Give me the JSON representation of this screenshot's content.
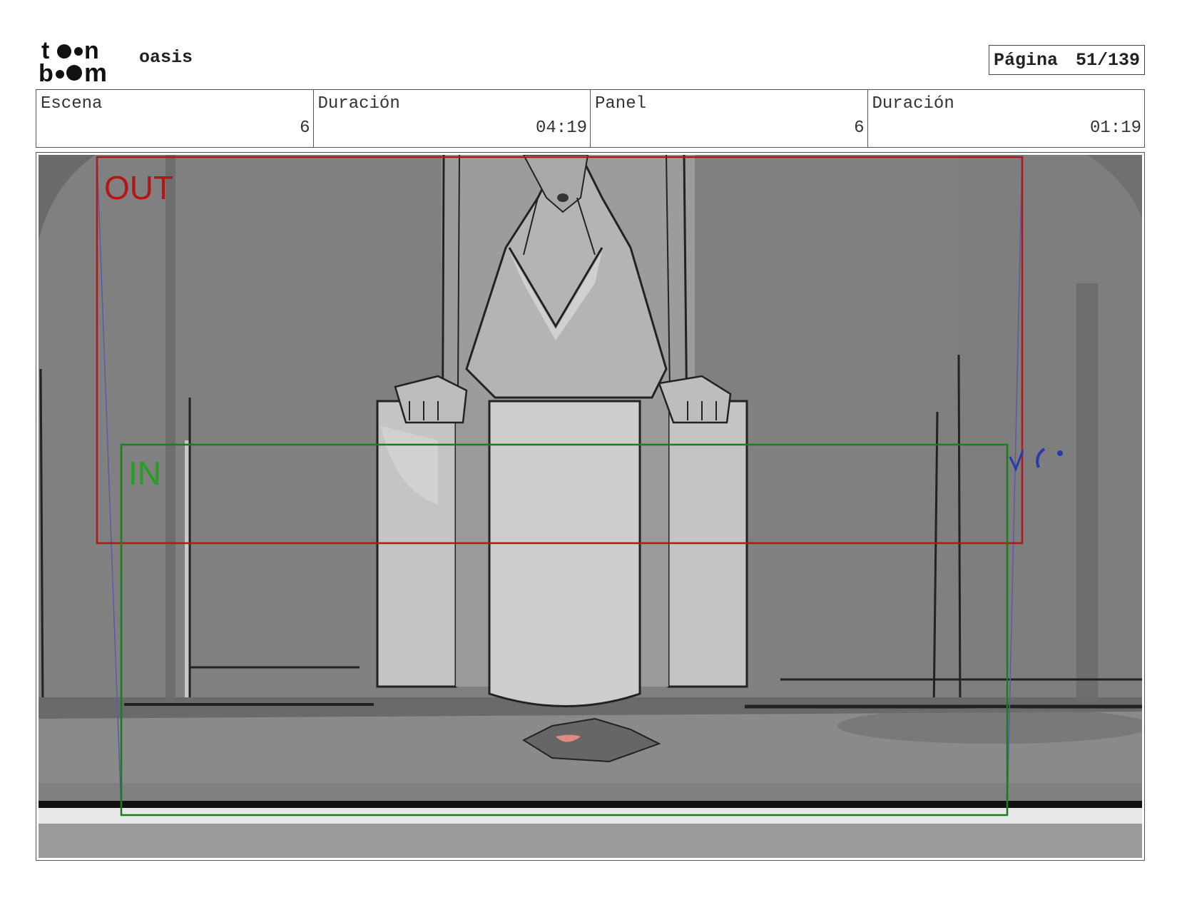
{
  "header": {
    "logo_text": "toon boom",
    "project_name": "oasis",
    "page_label": "Página",
    "page_number": "51/139"
  },
  "info": {
    "scene_label": "Escena",
    "scene_value": "6",
    "scene_duration_label": "Duración",
    "scene_duration_value": "04:19",
    "panel_label": "Panel",
    "panel_value": "6",
    "panel_duration_label": "Duración",
    "panel_duration_value": "01:19"
  },
  "panel": {
    "out_label": "OUT",
    "in_label": "IN",
    "colors": {
      "out_frame": "#b01818",
      "in_frame": "#1e7a1e",
      "camera_path": "#5a5aa8",
      "note": "#2a3aa8"
    }
  }
}
